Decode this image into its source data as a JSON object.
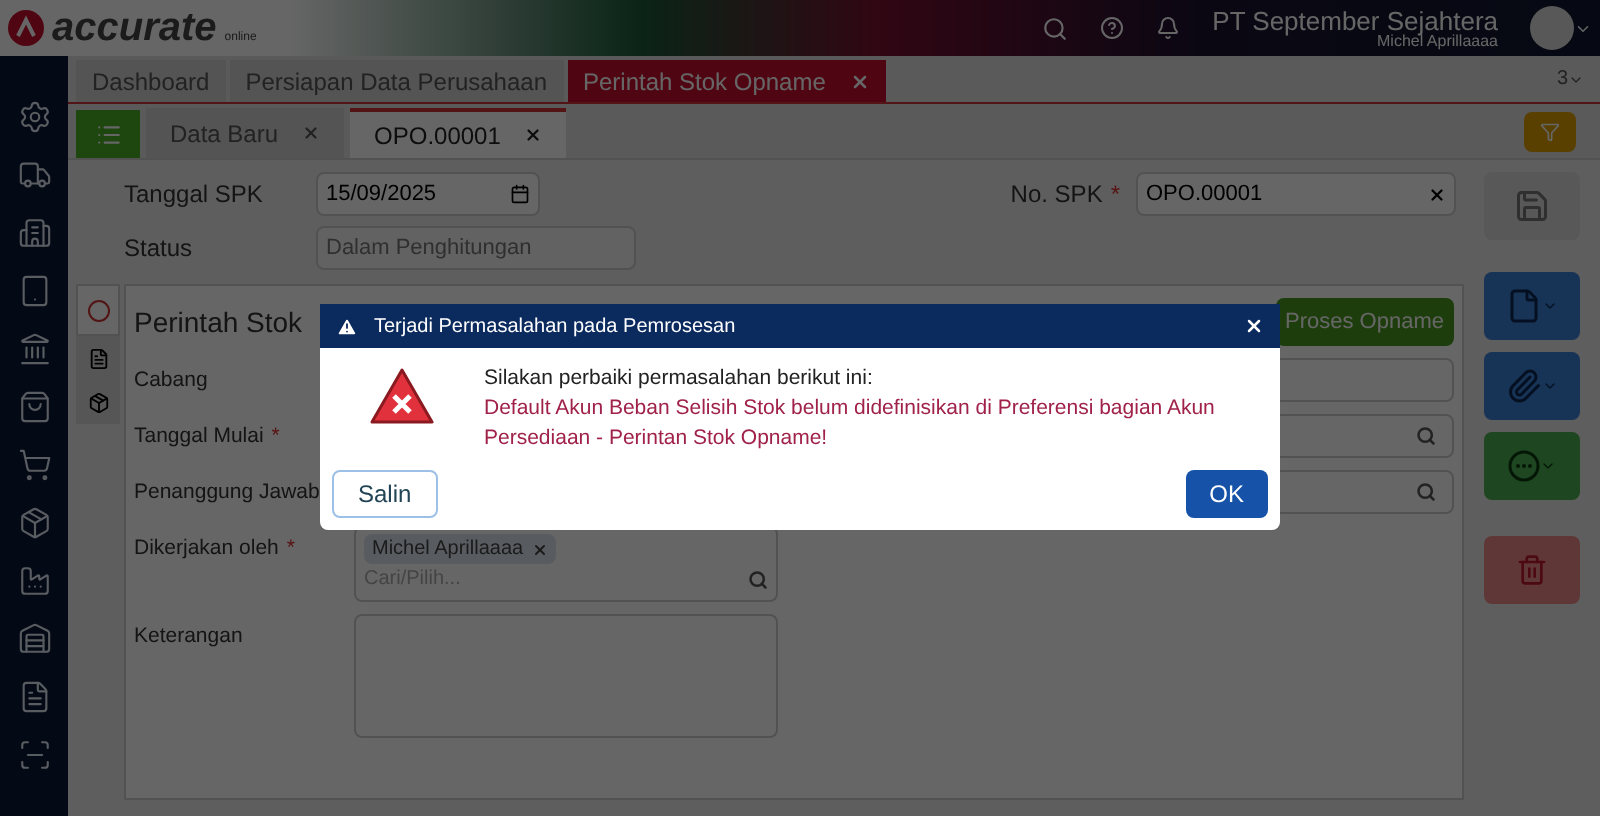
{
  "header": {
    "brand": "accurate",
    "brand_sub": "online",
    "company": "PT September Sejahtera",
    "user": "Michel Aprillaaaa"
  },
  "tabs": [
    {
      "label": "Dashboard",
      "selected": false,
      "closable": false
    },
    {
      "label": "Persiapan Data Perusahaan",
      "selected": false,
      "closable": false
    },
    {
      "label": "Perintah Stok Opname",
      "selected": true,
      "closable": true
    }
  ],
  "tab_counter": "3",
  "subtabs": [
    {
      "label": "Data Baru",
      "selected": false
    },
    {
      "label": "OPO.00001",
      "selected": true
    }
  ],
  "form": {
    "date_label": "Tanggal SPK",
    "date_value": "15/09/2025",
    "status_label": "Status",
    "status_value": "Dalam Penghitungan",
    "number_label": "No. SPK",
    "number_value": "OPO.00001",
    "number_required": true,
    "required_mark": "*"
  },
  "card": {
    "title": "Perintah Stok",
    "action": "Proses Opname",
    "fields": [
      {
        "label": "Cabang",
        "required": false,
        "kind": "text"
      },
      {
        "label": "Tanggal Mulai",
        "required": true,
        "kind": "search"
      },
      {
        "label": "Penanggung Jawab",
        "kind": "search"
      },
      {
        "label": "Dikerjakan oleh",
        "required": true,
        "kind": "multi",
        "chip": "Michel Aprillaaaa",
        "placeholder": "Cari/Pilih..."
      },
      {
        "label": "Keterangan",
        "required": false,
        "kind": "textarea"
      }
    ]
  },
  "dialog": {
    "title": "Terjadi Permasalahan pada Pemrosesan",
    "intro": "Silakan perbaiki permasalahan berikut ini:",
    "message": "Default Akun Beban Selisih Stok belum didefinisikan di Preferensi bagian Akun Persediaan - Perintan Stok Opname!",
    "buttons": [
      {
        "label": "Salin",
        "kind": "secondary"
      },
      {
        "label": "OK",
        "kind": "primary"
      }
    ]
  }
}
